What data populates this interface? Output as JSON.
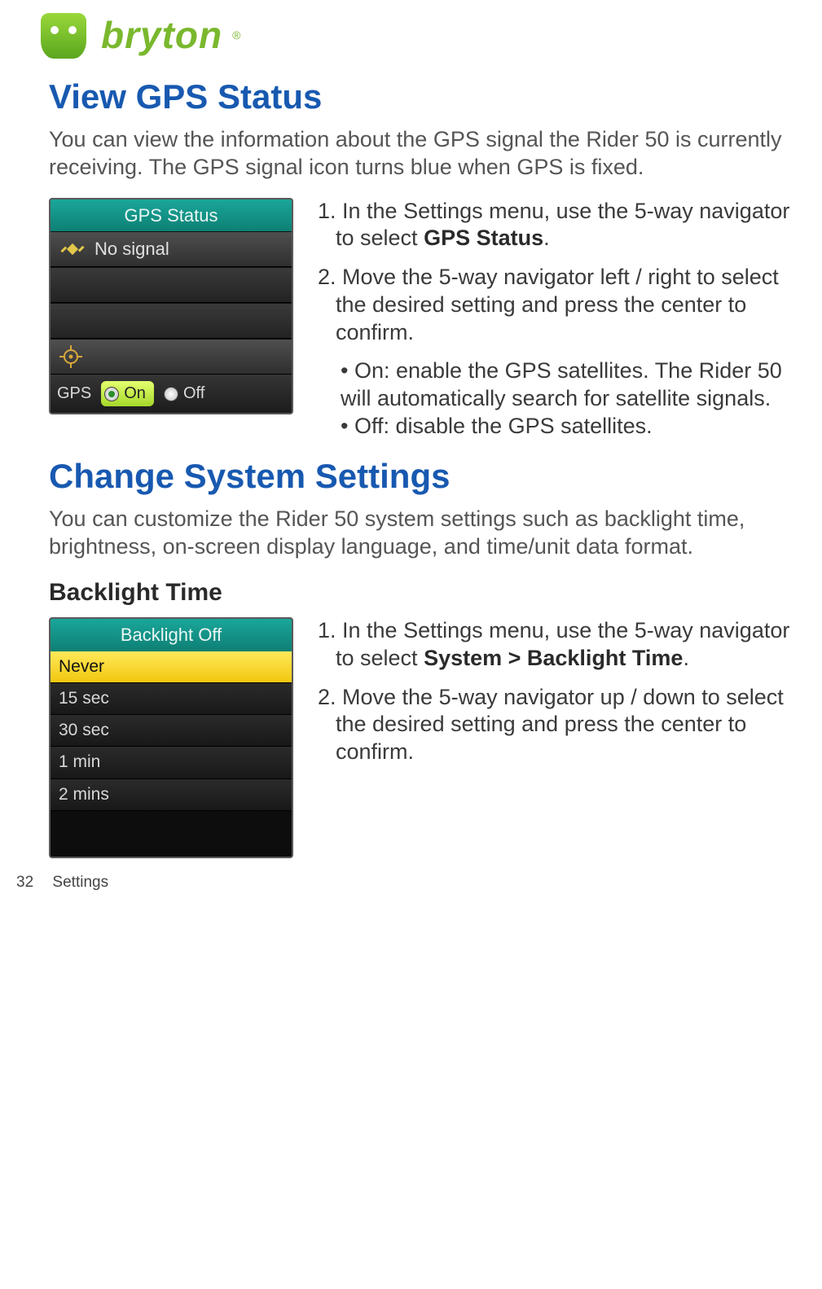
{
  "brand": {
    "name": "bryton"
  },
  "section_gps": {
    "heading": "View GPS Status",
    "intro": "You can view the information about the GPS signal the Rider 50 is currently receiving. The GPS signal icon turns blue when GPS is fixed.",
    "screen": {
      "title": "GPS Status",
      "signal_text": "No signal",
      "bottom_label": "GPS",
      "option_on": "On",
      "option_off": "Off"
    },
    "steps": {
      "s1_pre": "1. In the Settings menu, use the 5-way navigator to select ",
      "s1_bold": "GPS Status",
      "s1_post": ".",
      "s2": "2. Move the 5-way navigator left / right to select the desired setting and press the center to confirm.",
      "b1": "On: enable the GPS satellites. The Rider 50 will automatically search for satellite signals.",
      "b2": "Off: disable the GPS satellites."
    }
  },
  "section_sys": {
    "heading": "Change System Settings",
    "intro": "You can customize the Rider 50 system settings such as backlight time, brightness, on-screen display language, and time/unit data format.",
    "sub_heading": "Backlight Time",
    "screen": {
      "title": "Backlight Off",
      "items": [
        "Never",
        "15 sec",
        "30 sec",
        "1 min",
        "2 mins"
      ],
      "selected_index": 0
    },
    "steps": {
      "s1_pre": "1. In the Settings menu, use the 5-way navigator to select ",
      "s1_bold": "System > Backlight Time",
      "s1_post": ".",
      "s2": "2. Move the 5-way navigator up / down to select the desired setting and press the center to confirm."
    }
  },
  "footer": {
    "page_number": "32",
    "section_name": "Settings"
  }
}
